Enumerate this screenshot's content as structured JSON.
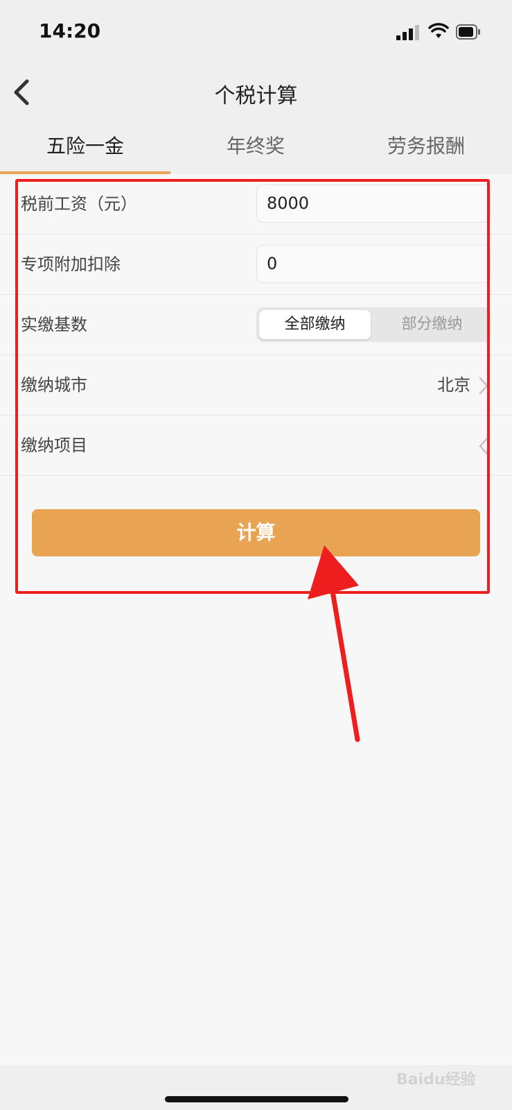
{
  "status_bar": {
    "time": "14:20"
  },
  "nav": {
    "title": "个税计算"
  },
  "tabs": [
    {
      "label": "五险一金",
      "active": true
    },
    {
      "label": "年终奖",
      "active": false
    },
    {
      "label": "劳务报酬",
      "active": false
    }
  ],
  "form": {
    "salary": {
      "label": "税前工资（元）",
      "value": "8000"
    },
    "deduction": {
      "label": "专项附加扣除",
      "value": "0"
    },
    "base": {
      "label": "实缴基数",
      "options": [
        "全部缴纳",
        "部分缴纳"
      ],
      "selected": "全部缴纳"
    },
    "city": {
      "label": "缴纳城市",
      "value": "北京"
    },
    "items": {
      "label": "缴纳项目"
    }
  },
  "calculate_button": {
    "label": "计算"
  },
  "watermark": "Baidu经验",
  "colors": {
    "accent": "#e8a452",
    "highlight": "#ee1e1e"
  }
}
